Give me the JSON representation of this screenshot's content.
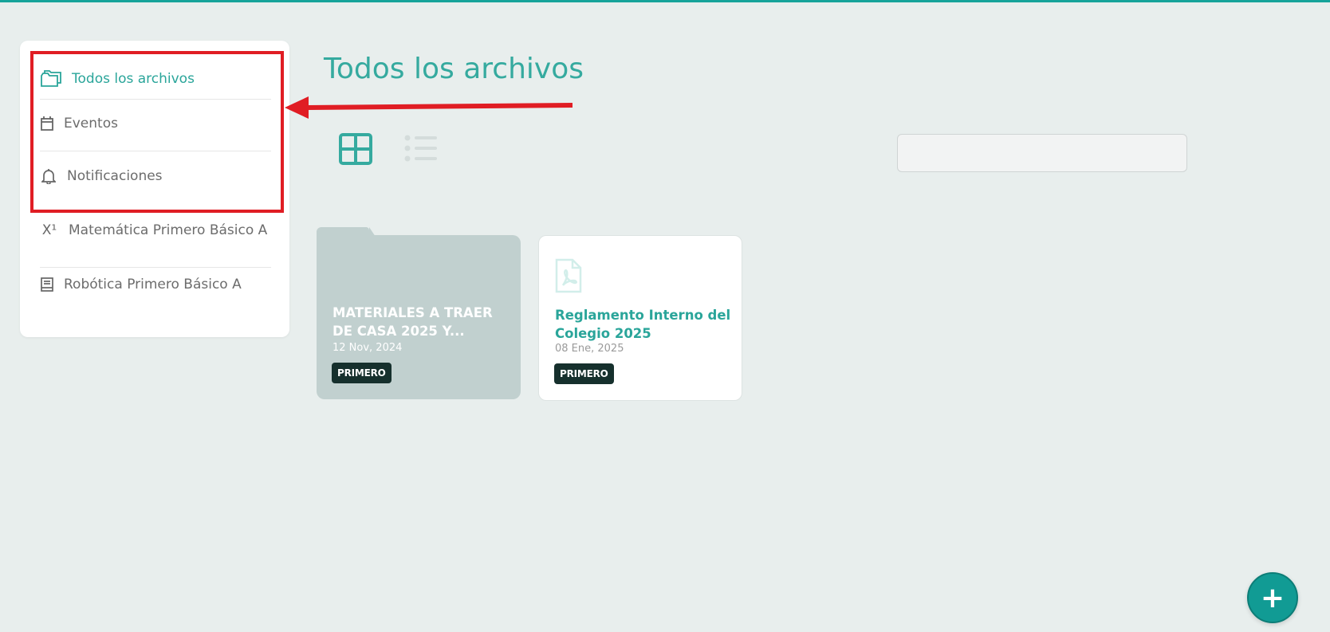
{
  "sidebar": {
    "items": [
      {
        "label": "Todos los archivos",
        "icon": "folders-icon",
        "active": true
      },
      {
        "label": "Eventos",
        "icon": "calendar-icon",
        "active": false
      },
      {
        "label": "Notificaciones",
        "icon": "bell-icon",
        "active": false
      },
      {
        "label": "Matemática Primero Básico A",
        "icon": "superscript-icon",
        "active": false
      },
      {
        "label": "Robótica Primero Básico A",
        "icon": "book-icon",
        "active": false
      }
    ]
  },
  "main": {
    "title": "Todos los archivos",
    "views": [
      "grid-view-icon",
      "list-view-icon"
    ],
    "search": {
      "value": "",
      "placeholder": ""
    },
    "cards": [
      {
        "type": "folder",
        "title": "MATERIALES A TRAER DE CASA 2025 Y...",
        "date": "12 Nov, 2024",
        "badge": "PRIMERO"
      },
      {
        "type": "file",
        "icon": "pdf-icon",
        "title": "Reglamento Interno del Colegio 2025",
        "date": "08 Ene, 2025",
        "badge": "PRIMERO"
      }
    ]
  },
  "fab": {
    "label": "+"
  },
  "colors": {
    "accent": "#2aa59a",
    "background": "#e8eeed",
    "folder": "#c1d0cf",
    "badge": "#16302d",
    "highlight": "#e01d24",
    "fab": "#119b94"
  }
}
